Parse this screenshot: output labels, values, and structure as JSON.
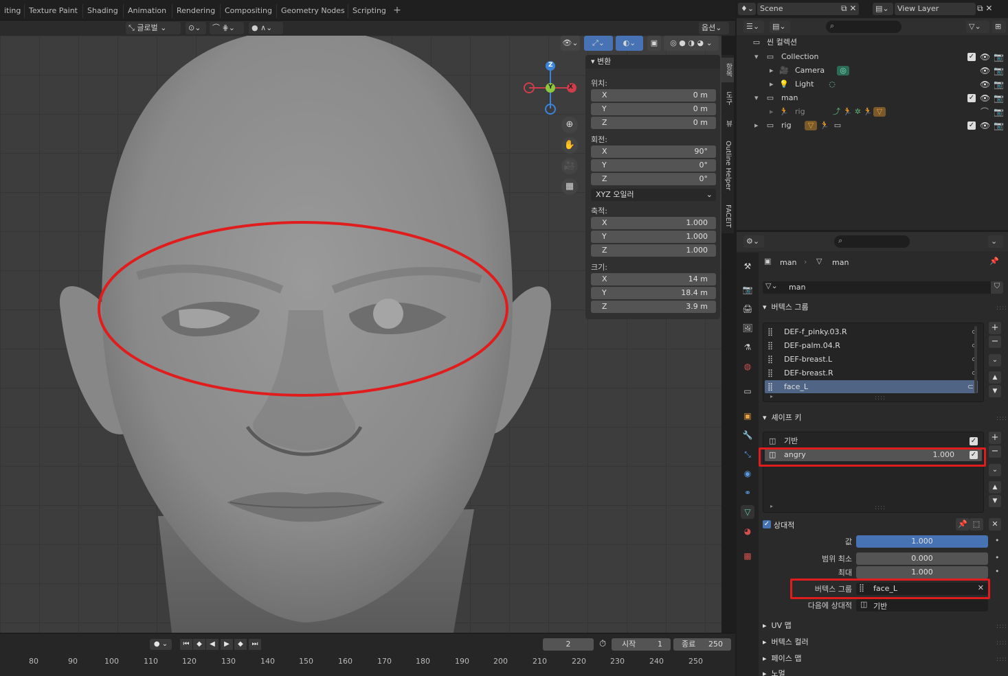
{
  "workspace_tabs": [
    "iting",
    "Texture Paint",
    "Shading",
    "Animation",
    "Rendering",
    "Compositing",
    "Geometry Nodes",
    "Scripting"
  ],
  "toolbar": {
    "orientation": "글로벌",
    "options": "옵션"
  },
  "npanel": {
    "title": "변환",
    "location_label": "위치:",
    "location": [
      {
        "axis": "X",
        "value": "0 m"
      },
      {
        "axis": "Y",
        "value": "0 m"
      },
      {
        "axis": "Z",
        "value": "0 m"
      }
    ],
    "rotation_label": "회전:",
    "rotation": [
      {
        "axis": "X",
        "value": "90°"
      },
      {
        "axis": "Y",
        "value": "0°"
      },
      {
        "axis": "Z",
        "value": "0°"
      }
    ],
    "rotation_mode": "XYZ 오일러",
    "scale_label": "축적:",
    "scale": [
      {
        "axis": "X",
        "value": "1.000"
      },
      {
        "axis": "Y",
        "value": "1.000"
      },
      {
        "axis": "Z",
        "value": "1.000"
      }
    ],
    "dimensions_label": "크기:",
    "dimensions": [
      {
        "axis": "X",
        "value": "14 m"
      },
      {
        "axis": "Y",
        "value": "18.4 m"
      },
      {
        "axis": "Z",
        "value": "3.9 m"
      }
    ],
    "tabs": [
      "항목",
      "도구",
      "뷰",
      "Outline Helper",
      "FACEIT"
    ]
  },
  "gizmo": {
    "x": "X",
    "y": "Y",
    "z": "Z"
  },
  "timeline": {
    "current_frame": "2",
    "start_label": "시작",
    "start": "1",
    "end_label": "종료",
    "end": "250",
    "ticks": [
      "80",
      "90",
      "100",
      "110",
      "120",
      "130",
      "140",
      "150",
      "160",
      "170",
      "180",
      "190",
      "200",
      "210",
      "220",
      "230",
      "240",
      "250"
    ]
  },
  "header_right": {
    "scene": "Scene",
    "view_layer": "View Layer"
  },
  "outliner": {
    "scene_collection": "씬 컬렉션",
    "rows": [
      {
        "name": "Collection",
        "indent": 1
      },
      {
        "name": "Camera",
        "indent": 2
      },
      {
        "name": "Light",
        "indent": 2
      },
      {
        "name": "man",
        "indent": 1
      },
      {
        "name": "rig",
        "indent": 2
      },
      {
        "name": "rig",
        "indent": 1
      }
    ]
  },
  "properties": {
    "breadcrumb_object": "man",
    "breadcrumb_data": "man",
    "mesh_name": "man",
    "vertex_groups_title": "버텍스 그룹",
    "vertex_groups": [
      "DEF-f_pinky.03.R",
      "DEF-palm.04.R",
      "DEF-breast.L",
      "DEF-breast.R",
      "face_L"
    ],
    "shape_keys_title": "셰이프 키",
    "shape_keys": [
      {
        "name": "기반",
        "value": ""
      },
      {
        "name": "angry",
        "value": "1.000"
      }
    ],
    "relative_label": "상대적",
    "value_label": "값",
    "value": "1.000",
    "range_min_label": "범위 최소",
    "range_min": "0.000",
    "max_label": "최대",
    "max": "1.000",
    "vertex_group_label": "버텍스 그룹",
    "vertex_group": "face_L",
    "relative_to_label": "다음에 상대적",
    "relative_to": "기반",
    "collapsed": [
      "UV 맵",
      "버텍스 컬러",
      "페이스 맵",
      "노멀"
    ]
  }
}
